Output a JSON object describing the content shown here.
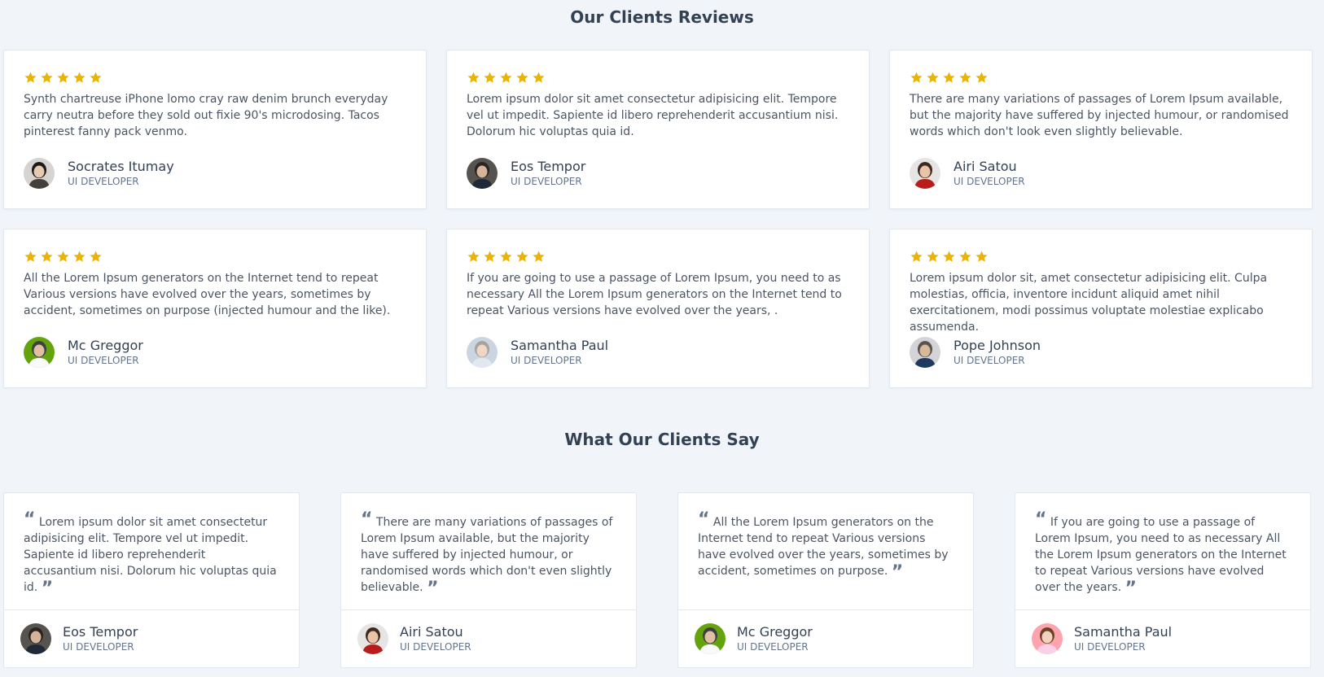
{
  "reviews_section": {
    "title": "Our Clients Reviews",
    "star_color": "#eab308",
    "star_count": 5,
    "cards": [
      {
        "rating": 5,
        "text": "Synth chartreuse iPhone lomo cray raw denim brunch everyday carry neutra before they sold out fixie 90's microdosing. Tacos pinterest fanny pack venmo.",
        "name": "Socrates Itumay",
        "role": "UI DEVELOPER",
        "avatar": "woman-dark-hair"
      },
      {
        "rating": 5,
        "text": "Lorem ipsum dolor sit amet consectetur adipisicing elit. Tempore vel ut impedit. Sapiente id libero reprehenderit accusantium nisi. Dolorum hic voluptas quia id.",
        "name": "Eos Tempor",
        "role": "UI DEVELOPER",
        "avatar": "man-dark-suit"
      },
      {
        "rating": 5,
        "text": "There are many variations of passages of Lorem Ipsum available, but the majority have suffered by injected humour, or randomised words which don't look even slightly believable.",
        "name": "Airi Satou",
        "role": "UI DEVELOPER",
        "avatar": "woman-red-top"
      },
      {
        "rating": 5,
        "text": "All the Lorem Ipsum generators on the Internet tend to repeat Various versions have evolved over the years, sometimes by accident, sometimes on purpose (injected humour and the like).",
        "name": "Mc Greggor",
        "role": "UI DEVELOPER",
        "avatar": "man-white-shirt"
      },
      {
        "rating": 5,
        "text": "If you are going to use a passage of Lorem Ipsum, you need to as necessary All the Lorem Ipsum generators on the Internet tend to repeat Various versions have evolved over the years, .",
        "name": "Samantha Paul",
        "role": "UI DEVELOPER",
        "avatar": "woman-light-hair"
      },
      {
        "rating": 5,
        "text": "Lorem ipsum dolor sit, amet consectetur adipisicing elit. Culpa molestias, officia, inventore incidunt aliquid amet nihil exercitationem, modi possimus voluptate molestiae explicabo assumenda.",
        "name": "Pope Johnson",
        "role": "UI DEVELOPER",
        "avatar": "man-casual"
      }
    ]
  },
  "testimonials_section": {
    "title": "What Our Clients Say",
    "cards": [
      {
        "text": "Lorem ipsum dolor sit amet consectetur adipisicing elit. Tempore vel ut impedit. Sapiente id libero reprehenderit accusantium nisi. Dolorum hic voluptas quia id.",
        "name": "Eos Tempor",
        "role": "UI DEVELOPER",
        "avatar": "man-dark-suit"
      },
      {
        "text": "There are many variations of passages of Lorem Ipsum available, but the majority have suffered by injected humour, or randomised words which don't even slightly believable.",
        "name": "Airi Satou",
        "role": "UI DEVELOPER",
        "avatar": "woman-red-top"
      },
      {
        "text": "All the Lorem Ipsum generators on the Internet tend to repeat Various versions have evolved over the years, sometimes by accident, sometimes on purpose.",
        "name": "Mc Greggor",
        "role": "UI DEVELOPER",
        "avatar": "man-white-shirt"
      },
      {
        "text": "If you are going to use a passage of Lorem Ipsum, you need to as necessary All the Lorem Ipsum generators on the Internet to repeat Various versions have evolved over the years.",
        "name": "Samantha Paul",
        "role": "UI DEVELOPER",
        "avatar": "woman-pink-bg"
      }
    ]
  }
}
